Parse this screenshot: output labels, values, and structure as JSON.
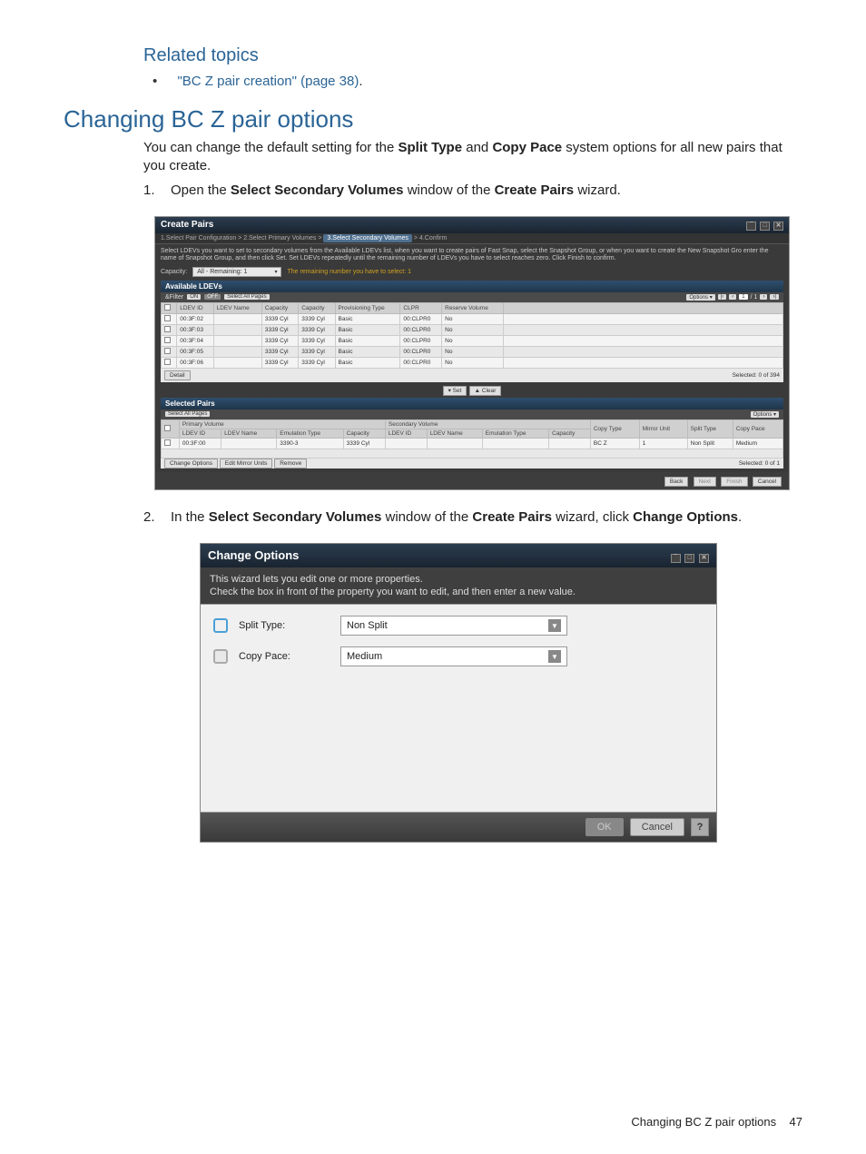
{
  "related": {
    "heading": "Related topics",
    "link_text": "\"BC Z pair creation\" (page 38)",
    "link_suffix": "."
  },
  "section": {
    "title": "Changing BC Z pair options",
    "intro_prefix": "You can change the default setting for the ",
    "intro_bold1": "Split Type",
    "intro_mid1": " and ",
    "intro_bold2": "Copy Pace",
    "intro_suffix": " system options for all new pairs that you create."
  },
  "step1": {
    "num": "1.",
    "t1": "Open the ",
    "b1": "Select Secondary Volumes",
    "t2": " window of the ",
    "b2": "Create Pairs",
    "t3": " wizard."
  },
  "step2": {
    "num": "2.",
    "t1": "In the ",
    "b1": "Select Secondary Volumes",
    "t2": " window of the ",
    "b2": "Create Pairs",
    "t3": " wizard, click ",
    "b3": "Change Options",
    "t4": "."
  },
  "shot1": {
    "title": "Create Pairs",
    "steps": {
      "s1": "1.Select Pair Configuration",
      "s2": "2.Select Primary Volumes",
      "s3": "3.Select Secondary Volumes",
      "s4": "4.Confirm",
      "sep": " > "
    },
    "instructions": "Select LDEVs you want to set to secondary volumes from the Available LDEVs list, when you want to create pairs of Fast Snap, select the Snapshot Group, or when you want to create the New Snapshot Gro enter the name of Snapshot Group, and then click Set. Set LDEVs repeatedly until the remaining number of LDEVs you have to select reaches zero. Click Finish to confirm.",
    "capacity_label": "Capacity:",
    "capacity_value": "All - Remaining: 1",
    "remaining_msg": "The remaining number you have to select:  1",
    "available_header": "Available LDEVs",
    "filter_label": "&Filter",
    "on": "ON",
    "off": "OFF",
    "select_all": "Select All Pages",
    "options": "Options",
    "page_of": "1",
    "page_total": "/ 1",
    "cols": [
      "LDEV ID",
      "LDEV Name",
      "Capacity",
      "Capacity",
      "Provisioning Type",
      "CLPR",
      "Reserve Volume"
    ],
    "rows": [
      {
        "id": "00:3F:02",
        "cap": "3339 Cyl",
        "cap2": "3339 Cyl",
        "pt": "Basic",
        "clpr": "00:CLPR0",
        "rv": "No"
      },
      {
        "id": "00:3F:03",
        "cap": "3339 Cyl",
        "cap2": "3339 Cyl",
        "pt": "Basic",
        "clpr": "00:CLPR0",
        "rv": "No"
      },
      {
        "id": "00:3F:04",
        "cap": "3339 Cyl",
        "cap2": "3339 Cyl",
        "pt": "Basic",
        "clpr": "00:CLPR0",
        "rv": "No"
      },
      {
        "id": "00:3F:05",
        "cap": "3339 Cyl",
        "cap2": "3339 Cyl",
        "pt": "Basic",
        "clpr": "00:CLPR0",
        "rv": "No"
      },
      {
        "id": "00:3F:06",
        "cap": "3339 Cyl",
        "cap2": "3339 Cyl",
        "pt": "Basic",
        "clpr": "00:CLPR0",
        "rv": "No"
      }
    ],
    "detail_btn": "Detail",
    "selected_label": "Selected: 0   of  394",
    "set_btn": "▾ Set",
    "clear_btn": "▲ Clear",
    "selected_header": "Selected Pairs",
    "sel_cols_primary": "Primary Volume",
    "sel_cols_secondary": "Secondary Volume",
    "sel_cols": [
      "LDEV ID",
      "LDEV Name",
      "Emulation Type",
      "Capacity",
      "LDEV ID",
      "LDEV Name",
      "Emulation Type",
      "Capacity",
      "Copy Type",
      "Mirror Unit",
      "Split Type",
      "Copy Pace"
    ],
    "sel_row": {
      "ldev": "00:3F:00",
      "emu": "3390-3",
      "cap": "3339 Cyl",
      "ct": "BC Z",
      "mu": "1",
      "st": "Non Split",
      "cp": "Medium"
    },
    "change_options": "Change Options",
    "edit_mirror": "Edit Mirror Units",
    "remove": "Remove",
    "sel_footer": "Selected: 0   of  1",
    "back": "Back",
    "next": "Next",
    "finish": "Finish",
    "cancel": "Cancel"
  },
  "shot2": {
    "title": "Change Options",
    "instr_l1": "This wizard lets you edit one or more properties.",
    "instr_l2": "Check the box in front of the property you want to edit, and then enter a new value.",
    "split_label": "Split Type:",
    "split_value": "Non Split",
    "pace_label": "Copy Pace:",
    "pace_value": "Medium",
    "ok": "OK",
    "cancel": "Cancel",
    "help": "?"
  },
  "footer": {
    "text": "Changing BC Z pair options",
    "page": "47"
  }
}
